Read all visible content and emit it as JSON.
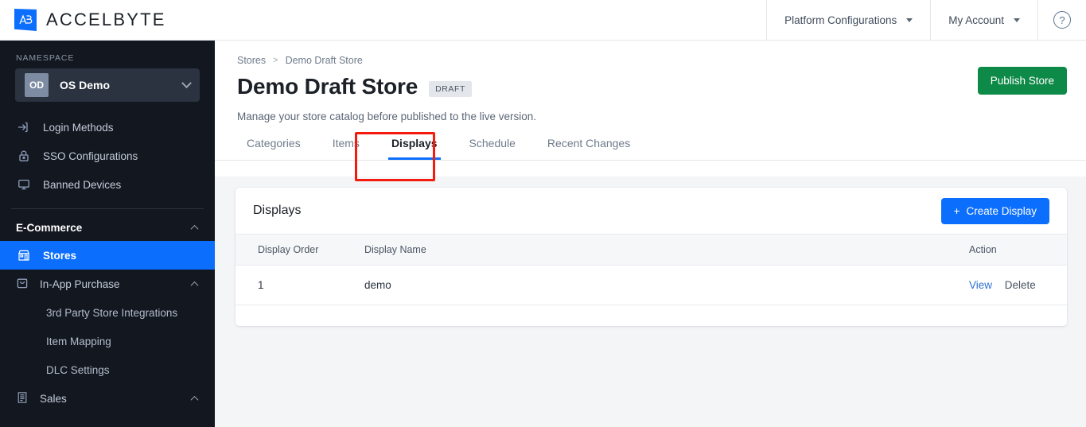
{
  "brand": {
    "name": "ACCELBYTE",
    "logo_icon": "accelbyte-logo-icon"
  },
  "topbar": {
    "platform_configurations": "Platform Configurations",
    "my_account": "My Account",
    "help_icon": "help-circle-icon",
    "help_glyph": "?"
  },
  "sidebar": {
    "namespace_label": "NAMESPACE",
    "namespace": {
      "initials": "OD",
      "name": "OS Demo"
    },
    "items": [
      {
        "label": "Login Methods",
        "icon": "login-arrow-icon"
      },
      {
        "label": "SSO Configurations",
        "icon": "lock-icon"
      },
      {
        "label": "Banned Devices",
        "icon": "monitor-icon"
      }
    ],
    "group_ecommerce": {
      "label": "E-Commerce",
      "icon": "chevron-up-icon"
    },
    "stores": {
      "label": "Stores",
      "icon": "store-icon"
    },
    "in_app_purchase": {
      "label": "In-App Purchase",
      "icon": "bag-icon",
      "chevron": "chevron-up-icon"
    },
    "in_app_children": [
      {
        "label": "3rd Party Store Integrations"
      },
      {
        "label": "Item Mapping"
      },
      {
        "label": "DLC Settings"
      }
    ],
    "sales": {
      "label": "Sales",
      "icon": "receipt-icon",
      "chevron": "chevron-up-icon"
    }
  },
  "main": {
    "breadcrumb": {
      "root": "Stores",
      "separator": ">",
      "current": "Demo Draft Store"
    },
    "page_title": "Demo Draft Store",
    "status_badge": "DRAFT",
    "publish_button": "Publish Store",
    "subtitle": "Manage your store catalog before published to the live version.",
    "tabs": [
      {
        "label": "Categories",
        "active": false
      },
      {
        "label": "Items",
        "active": false
      },
      {
        "label": "Displays",
        "active": true
      },
      {
        "label": "Schedule",
        "active": false
      },
      {
        "label": "Recent Changes",
        "active": false
      }
    ]
  },
  "card": {
    "title": "Displays",
    "create_button": "Create Display",
    "create_plus": "+",
    "columns": [
      "Display Order",
      "Display Name",
      "Action"
    ],
    "rows": [
      {
        "order": "1",
        "name": "demo",
        "view": "View",
        "delete": "Delete"
      }
    ]
  },
  "colors": {
    "accent_blue": "#0b6efd",
    "publish_green": "#0e8a48",
    "sidebar_bg": "#131720",
    "annotation_red": "#f51a0e",
    "link_blue": "#2f6fd0"
  }
}
